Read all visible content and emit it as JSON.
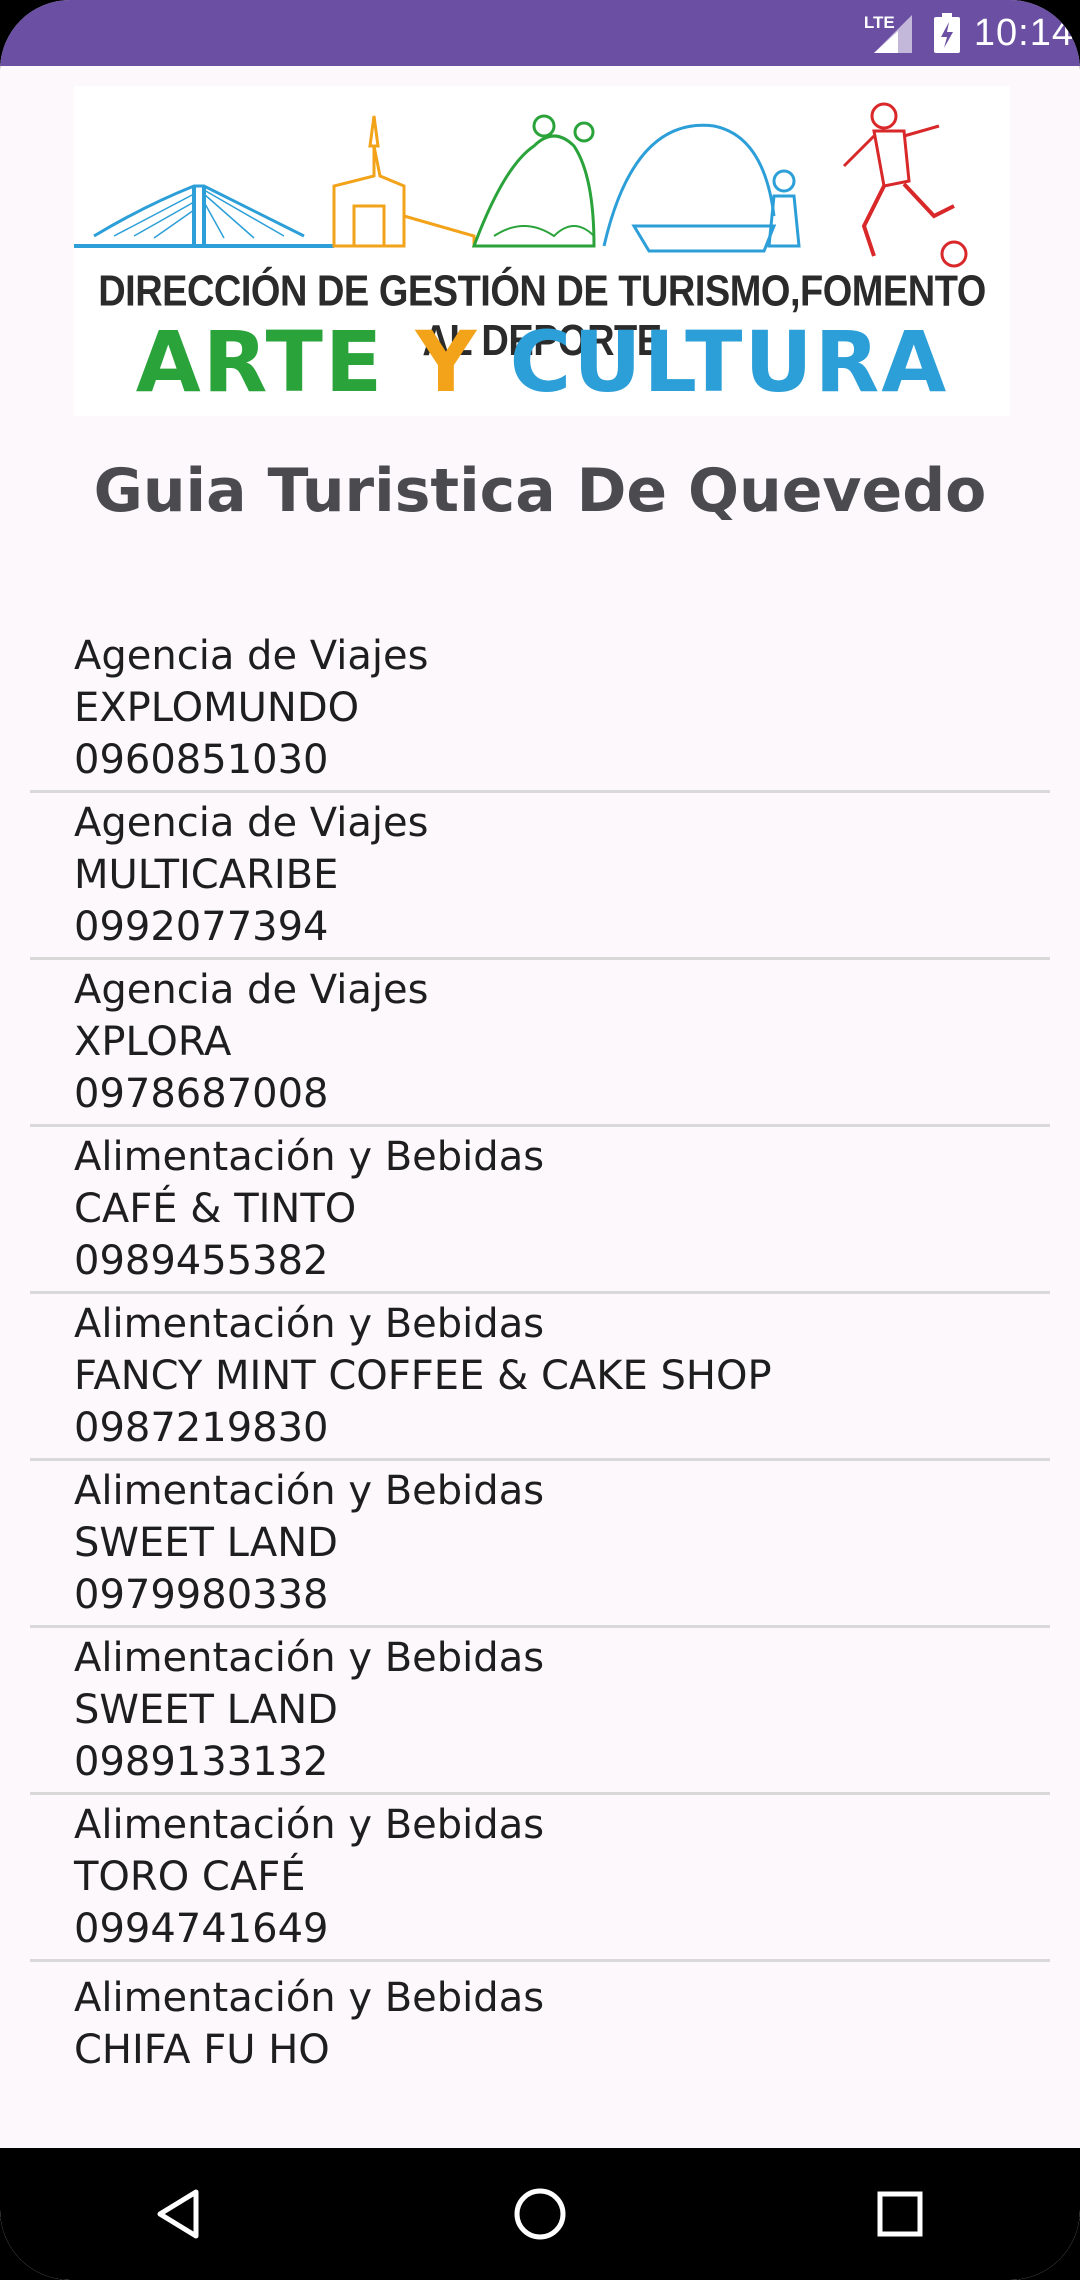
{
  "status_bar": {
    "network": "LTE",
    "time": "10:14"
  },
  "banner": {
    "subtitle": "DIRECCIÓN DE GESTIÓN DE TURISMO,FOMENTO AL DEPORTE",
    "title_word1": "ARTE",
    "title_word2": "Y",
    "title_word3": "CULTURA",
    "colors": {
      "green": "#2aa33a",
      "orange": "#f2a31a",
      "blue": "#2d9fd8",
      "red": "#d8282a"
    }
  },
  "page": {
    "title": "Guia Turistica De Quevedo"
  },
  "list": {
    "items": [
      {
        "category": "Agencia de Viajes",
        "name": "EXPLOMUNDO",
        "phone": "0960851030"
      },
      {
        "category": "Agencia de Viajes",
        "name": "MULTICARIBE",
        "phone": "0992077394"
      },
      {
        "category": "Agencia de Viajes",
        "name": "XPLORA",
        "phone": "0978687008"
      },
      {
        "category": "Alimentación y Bebidas",
        "name": "CAFÉ & TINTO",
        "phone": "0989455382"
      },
      {
        "category": "Alimentación y Bebidas",
        "name": "FANCY MINT COFFEE & CAKE SHOP",
        "phone": "0987219830"
      },
      {
        "category": "Alimentación y Bebidas",
        "name": "SWEET LAND",
        "phone": "0979980338"
      },
      {
        "category": "Alimentación y Bebidas",
        "name": "SWEET LAND",
        "phone": "0989133132"
      },
      {
        "category": "Alimentación y Bebidas",
        "name": "TORO CAFÉ",
        "phone": "0994741649"
      },
      {
        "category": "Alimentación y Bebidas",
        "name": "CHIFA FU HO",
        "phone": ""
      }
    ]
  },
  "nav": {
    "back_icon": "back-triangle",
    "home_icon": "home-circle",
    "recents_icon": "recents-square"
  },
  "theme": {
    "status_bar_color": "#6a4fa3",
    "background": "#fcf8fc"
  }
}
